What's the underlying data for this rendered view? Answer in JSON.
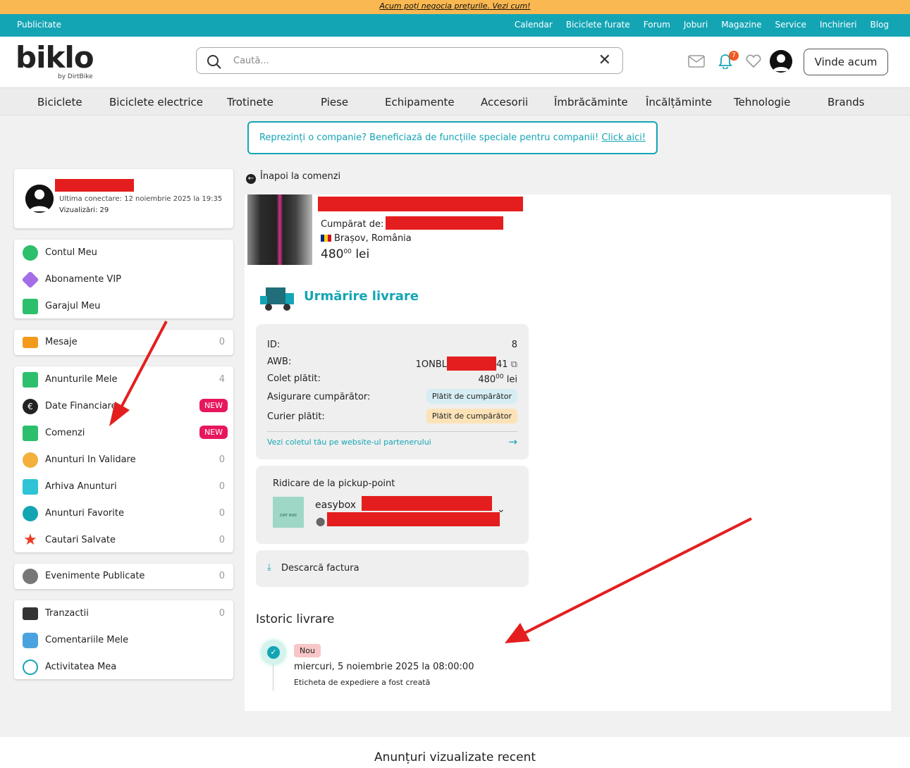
{
  "promo": {
    "text": "Acum poți negocia prețurile. Vezi cum!"
  },
  "topbar": {
    "left": "Publicitate",
    "links": [
      "Calendar",
      "Biciclete furate",
      "Forum",
      "Joburi",
      "Magazine",
      "Service",
      "Inchirieri",
      "Blog"
    ]
  },
  "logo": {
    "word": "biklo",
    "by": "by DirtBike"
  },
  "search": {
    "placeholder": "Caută..."
  },
  "notifications": {
    "count": "7"
  },
  "header": {
    "sell_label": "Vinde acum"
  },
  "categories": [
    "Biciclete",
    "Biciclete electrice",
    "Trotinete",
    "Piese",
    "Echipamente",
    "Accesorii",
    "Îmbrăcăminte",
    "Încălțăminte",
    "Tehnologie",
    "Brands"
  ],
  "company_banner": {
    "text": "Reprezinți o companie? Beneficiază de funcțiile speciale pentru companii!",
    "link": "Click aici!"
  },
  "profile": {
    "last_login": "Ultima conectare: 12 noiembrie 2025 la 19:35",
    "views": "Vizualizări: 29"
  },
  "menu": {
    "group1": [
      {
        "label": "Contul Meu",
        "icon": "user-icon",
        "color": "#2dbf6c"
      },
      {
        "label": "Abonamente VIP",
        "icon": "diamond-icon",
        "color": "#a46ee8"
      },
      {
        "label": "Garajul Meu",
        "icon": "garage-icon",
        "color": "#2dbf6c"
      }
    ],
    "group2": [
      {
        "label": "Mesaje",
        "count": "0",
        "icon": "mail-icon",
        "color": "#f39a1c"
      }
    ],
    "group3": [
      {
        "label": "Anunturile Mele",
        "count": "4",
        "icon": "folder-icon",
        "color": "#2dbf6c"
      },
      {
        "label": "Date Financiare",
        "badge": "NEW",
        "icon": "euro-icon",
        "color": "#222"
      },
      {
        "label": "Comenzi",
        "badge": "NEW",
        "icon": "truck-icon",
        "color": "#2dbf6c"
      },
      {
        "label": "Anunturi In Validare",
        "count": "0",
        "icon": "clock-icon",
        "color": "#f3b13c"
      },
      {
        "label": "Arhiva Anunturi",
        "count": "0",
        "icon": "archive-icon",
        "color": "#2ec4d6"
      },
      {
        "label": "Anunturi Favorite",
        "count": "0",
        "icon": "heart-icon",
        "color": "#14a5b5"
      },
      {
        "label": "Cautari Salvate",
        "count": "0",
        "icon": "star-icon",
        "color": "#ef3a22"
      }
    ],
    "group4": [
      {
        "label": "Evenimente Publicate",
        "count": "0",
        "icon": "play-icon",
        "color": "#777"
      }
    ],
    "group5": [
      {
        "label": "Tranzactii",
        "count": "0",
        "icon": "wallet-icon",
        "color": "#333"
      },
      {
        "label": "Comentariile Mele",
        "icon": "comment-icon",
        "color": "#4aa3df"
      },
      {
        "label": "Activitatea Mea",
        "icon": "fingerprint-icon",
        "color": "#14a5b5"
      }
    ]
  },
  "order": {
    "back": "Înapoi la comenzi",
    "bought_by": "Cumpărat de:",
    "location": "Brașov, România",
    "price_main": "480",
    "price_dec": "00",
    "price_cur": "lei",
    "tracking_title": "Urmărire livrare",
    "details": {
      "id_label": "ID:",
      "id_value": "8",
      "awb_label": "AWB:",
      "awb_prefix": "1ONBL",
      "awb_suffix": "41",
      "paid_label": "Colet plătit:",
      "paid_main": "480",
      "paid_dec": "00",
      "paid_cur": "lei",
      "insurance_label": "Asigurare cumpărător:",
      "insurance_value": "Plătit de cumpărător",
      "courier_label": "Curier plătit:",
      "courier_value": "Plătit de cumpărător",
      "partner_link": "Vezi coletul tău pe website-ul partenerului"
    },
    "pickup": {
      "title": "Ridicare de la pickup-point",
      "name": "easybox",
      "logo_text": "DIRT BIKE"
    },
    "invoice": "Descarcă factura",
    "history": {
      "title": "Istoric livrare",
      "status": "Nou",
      "date": "miercuri, 5 noiembrie 2025 la 08:00:00",
      "desc": "Eticheta de expediere a fost creată"
    }
  },
  "recent": {
    "title": "Anunțuri vizualizate recent"
  },
  "colors": {
    "accent": "#14a5b5",
    "promo": "#f9b851",
    "new_badge": "#e8175d",
    "annotation_arrow": "#e41e1e"
  }
}
